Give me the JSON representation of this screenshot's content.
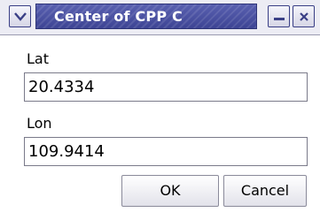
{
  "window": {
    "title": "Center of CPP C"
  },
  "titlebar_icons": {
    "menu": "chevron-down-icon",
    "minimize": "minimize-icon",
    "close": "close-icon"
  },
  "fields": {
    "lat": {
      "label": "Lat",
      "value": "20.4334"
    },
    "lon": {
      "label": "Lon",
      "value": "109.9414"
    }
  },
  "buttons": {
    "ok_label": "OK",
    "cancel_label": "Cancel"
  },
  "colors": {
    "title_bar": "#3d4494",
    "title_text": "#ffffff"
  }
}
